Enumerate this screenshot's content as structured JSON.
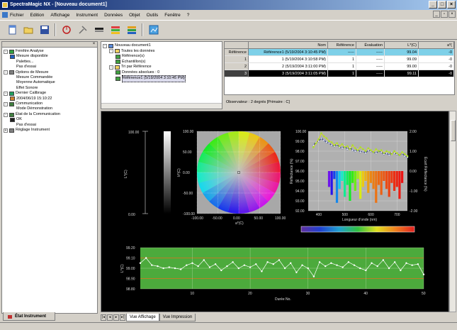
{
  "app": {
    "title": "SpectraMagic NX - [Nouveau document1]"
  },
  "menu": [
    "Fichier",
    "Edition",
    "Affichage",
    "Instrument",
    "Données",
    "Objet",
    "Outils",
    "Fenêtre",
    "?"
  ],
  "toolbar": {
    "icons": [
      "new-icon",
      "open-icon",
      "save-icon",
      "instrument-icon",
      "tools-icon",
      "calibrate-icon",
      "color-bars-icon",
      "display-icon",
      "measure-icon"
    ]
  },
  "left_panel": {
    "tab_label": "État Instrument",
    "items": [
      {
        "label": "Fenêtre Analyse",
        "level": 0,
        "exp": "-",
        "icon": "window"
      },
      {
        "label": "Mesure disponible",
        "level": 1,
        "icon": "check"
      },
      {
        "label": "Palettes...",
        "level": 2
      },
      {
        "label": "Pas d'essai",
        "level": 2
      },
      {
        "label": "Options de Mesure",
        "level": 0,
        "exp": "-",
        "icon": "gear"
      },
      {
        "label": "Mesure Commandée",
        "level": 2
      },
      {
        "label": "Moyenne Automatique",
        "level": 2
      },
      {
        "label": "Effet Sonore",
        "level": 2
      },
      {
        "label": "Dernier Calibrage",
        "level": 0,
        "exp": "-",
        "icon": "cal"
      },
      {
        "label": "2004/06/19 15:10:22",
        "level": 1,
        "icon": "clock"
      },
      {
        "label": "Communication",
        "level": 0,
        "exp": "-",
        "icon": "comm"
      },
      {
        "label": "Mode Démonstration",
        "level": 2
      },
      {
        "label": "État de la Communication",
        "level": 0,
        "exp": "-",
        "icon": "comm"
      },
      {
        "label": "OK",
        "level": 1,
        "icon": "ok"
      },
      {
        "label": "Pas d'essai",
        "level": 2
      },
      {
        "label": "Réglage Instrument",
        "level": 0,
        "exp": "+",
        "icon": "gear"
      }
    ]
  },
  "file_tree": {
    "items": [
      {
        "label": "Nouveau document1",
        "level": 0,
        "exp": "-"
      },
      {
        "label": "Toutes les données",
        "level": 1,
        "exp": "-"
      },
      {
        "label": "Référence(s)",
        "level": 2
      },
      {
        "label": "Échantillon(s)",
        "level": 2
      },
      {
        "label": "Tri par Référence",
        "level": 1,
        "exp": "-"
      },
      {
        "label": "Données absolues : 0",
        "level": 2
      },
      {
        "label": "Référence1 (5/19/2004 3:10:45 PM)",
        "level": 2,
        "sel": true
      }
    ]
  },
  "data_table": {
    "headers": [
      "",
      "Nom",
      "Référence",
      "Évaluation",
      "L*(C)",
      "a*("
    ],
    "rows": [
      {
        "h": "Référence",
        "cells": [
          "Référence1 (5/19/2004 3:10:45 PM)",
          "-----",
          "-----",
          "99.04",
          "-0"
        ],
        "style": "sel"
      },
      {
        "h": "1",
        "cells": [
          "1 (5/19/2004 3:10:58 PM)",
          "1",
          "-----",
          "99.09",
          "-0"
        ],
        "style": ""
      },
      {
        "h": "2",
        "cells": [
          "2 (5/19/2004 3:11:00 PM)",
          "1",
          "-----",
          "99.00",
          "-0"
        ],
        "style": ""
      },
      {
        "h": "3",
        "cells": [
          "3 (5/19/2004 3:11:05 PM)",
          "1",
          "-----",
          "99.11",
          "-0"
        ],
        "style": "dk"
      }
    ],
    "info": "Observateur : 2 degrés  [Primaire : C]"
  },
  "tabs": [
    "Vue Affichage",
    "Vue Impression"
  ],
  "chart_data": [
    {
      "type": "scatter",
      "title": "",
      "xlabel": "a*(C)",
      "ylabel": "b*(C)",
      "xticks": [
        "-100.00",
        "-50.00",
        "0.00",
        "50.00",
        "100.00"
      ],
      "yticks": [
        "100.00",
        "50.00",
        "0.00",
        "-50.00",
        "-100.00"
      ],
      "xlim": [
        -100,
        100
      ],
      "ylim": [
        -100,
        100
      ],
      "x": [
        0
      ],
      "y": [
        0
      ],
      "lightness": {
        "label": "L*(C)",
        "top": "100.00",
        "bottom": "0.00"
      }
    },
    {
      "type": "line",
      "title": "",
      "xlabel": "Longueur d'onde (nm)",
      "ylabel": "Réflectance (%)",
      "y2label": "Écart Réflectance (%)",
      "xticks": [
        "400",
        "500",
        "600",
        "700"
      ],
      "yticks": [
        "100.00",
        "99.00",
        "98.00",
        "97.00",
        "96.00",
        "95.00",
        "94.00",
        "93.00",
        "92.00"
      ],
      "y2ticks": [
        "2.00",
        "1.00",
        "0.00",
        "-1.00",
        "-2.00"
      ],
      "xlim": [
        360,
        740
      ],
      "ylim": [
        92,
        100
      ],
      "y2lim": [
        -2,
        2
      ],
      "series": [
        {
          "x": [
            380,
            390,
            400,
            410,
            420,
            430,
            440,
            450,
            460,
            470,
            480,
            490,
            500,
            510,
            520,
            530,
            540,
            550,
            560,
            570,
            580,
            590,
            600,
            610,
            620,
            630,
            640,
            650,
            660,
            670,
            680,
            690,
            700,
            710,
            720,
            730,
            740
          ],
          "values": [
            98.6,
            98.9,
            99.0,
            99.3,
            99.1,
            98.9,
            98.8,
            98.6,
            98.5,
            98.7,
            98.4,
            98.3,
            98.5,
            98.2,
            98.4,
            98.1,
            98.0,
            98.2,
            97.9,
            98.0,
            97.8,
            98.1,
            98.0,
            97.9,
            97.8,
            98.0,
            97.9,
            97.7,
            97.8,
            97.6,
            97.9,
            97.8,
            97.7,
            97.6,
            97.8,
            97.5,
            97.4
          ]
        },
        {
          "x": [
            380,
            390,
            400,
            410,
            420,
            430,
            440,
            450,
            460,
            470,
            480,
            490,
            500,
            510,
            520,
            530,
            540,
            550,
            560,
            570,
            580,
            590,
            600,
            610,
            620,
            630,
            640,
            650,
            660,
            670,
            680,
            690,
            700,
            710,
            720,
            730,
            740
          ],
          "values": [
            98.4,
            98.8,
            99.2,
            99.8,
            99.5,
            99.3,
            99.0,
            98.9,
            98.6,
            98.8,
            98.5,
            98.7,
            98.4,
            98.5,
            98.2,
            98.6,
            98.3,
            98.1,
            98.4,
            98.2,
            98.0,
            98.3,
            98.1,
            97.9,
            98.2,
            98.0,
            98.1,
            97.8,
            98.0,
            97.9,
            97.7,
            98.0,
            97.8,
            97.6,
            97.9,
            97.7,
            97.5
          ]
        }
      ],
      "diff": {
        "x": [
          440,
          450,
          460,
          470,
          480,
          490,
          500,
          510,
          520,
          530,
          540,
          550,
          560,
          570,
          580,
          590,
          600,
          610,
          620,
          630,
          640,
          650,
          660,
          670,
          680,
          690,
          700,
          710,
          720
        ],
        "values": [
          -0.8,
          -1.2,
          -0.4,
          -1.6,
          -0.9,
          -0.5,
          -1.3,
          -0.7,
          -1.5,
          -0.6,
          -1.0,
          -0.4,
          -1.4,
          -0.8,
          -0.5,
          -1.1,
          -0.6,
          -0.9,
          -1.6,
          -0.7,
          -1.2,
          -0.5,
          -0.9,
          -1.3,
          -0.6,
          -1.0,
          -0.8,
          -1.4,
          -0.6
        ]
      }
    },
    {
      "type": "line",
      "title": "",
      "xlabel": "Durée No.",
      "ylabel": "L*(C)",
      "xticks": [
        "10",
        "20",
        "30",
        "40",
        "50"
      ],
      "yticks": [
        "99.20",
        "99.10",
        "99.00",
        "98.90",
        "98.80"
      ],
      "xlim": [
        1,
        50
      ],
      "ylim": [
        98.8,
        99.2
      ],
      "series": [
        {
          "x": [
            1,
            2,
            3,
            4,
            5,
            6,
            7,
            8,
            9,
            10,
            11,
            12,
            13,
            14,
            15,
            16,
            17,
            18,
            19,
            20,
            21,
            22,
            23,
            24,
            25,
            26,
            27,
            28,
            29,
            30,
            31,
            32,
            33,
            34,
            35,
            36,
            37,
            38,
            39,
            40,
            41,
            42,
            43,
            44,
            45,
            46,
            47,
            48,
            49,
            50
          ],
          "values": [
            99.05,
            99.1,
            99.03,
            99.02,
            99.0,
            99.01,
            99.0,
            98.99,
            99.03,
            99.05,
            99.02,
            99.08,
            99.01,
            99.04,
            98.98,
            99.02,
            99.06,
            99.0,
            99.03,
            99.01,
            99.04,
            98.97,
            99.06,
            99.04,
            99.08,
            99.0,
            99.05,
            98.96,
            99.03,
            99.0,
            98.92,
            99.06,
            99.02,
            99.05,
            99.03,
            99.01,
            99.06,
            99.03,
            99.0,
            98.98,
            99.05,
            99.02,
            99.08,
            99.0,
            99.06,
            98.98,
            99.05,
            99.03,
            99.04,
            98.94
          ]
        }
      ]
    }
  ]
}
